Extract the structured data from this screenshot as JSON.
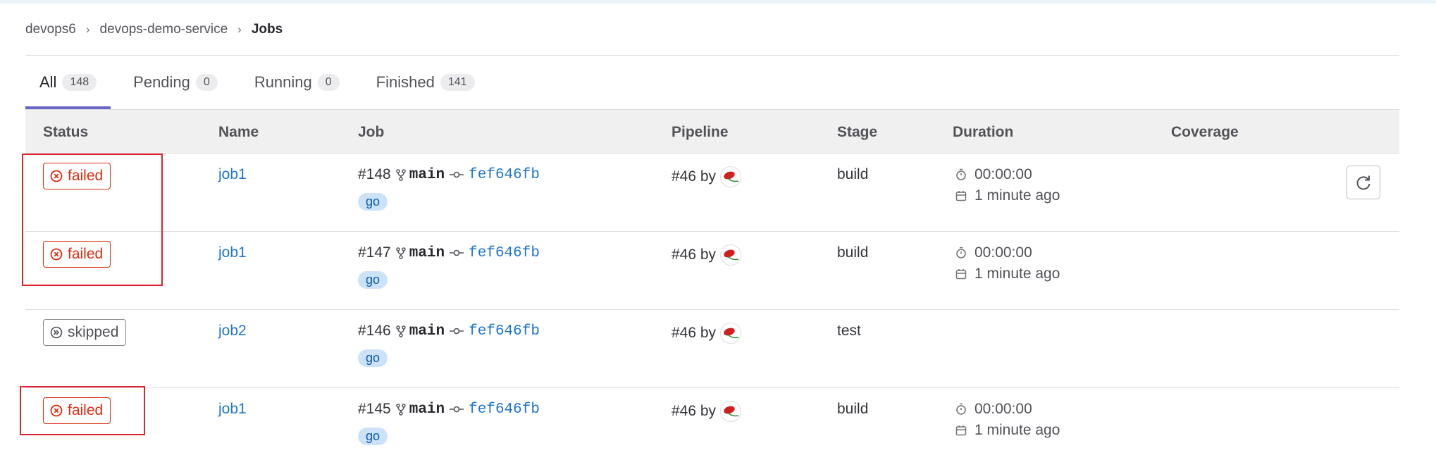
{
  "breadcrumb": {
    "items": [
      "devops6",
      "devops-demo-service"
    ],
    "current": "Jobs"
  },
  "tabs": [
    {
      "label": "All",
      "count": "148"
    },
    {
      "label": "Pending",
      "count": "0"
    },
    {
      "label": "Running",
      "count": "0"
    },
    {
      "label": "Finished",
      "count": "141"
    }
  ],
  "columns": [
    "Status",
    "Name",
    "Job",
    "Pipeline",
    "Stage",
    "Duration",
    "Coverage"
  ],
  "rows": [
    {
      "status": "failed",
      "name": "job1",
      "id": "#148",
      "branch": "main",
      "sha": "fef646fb",
      "tag": "go",
      "pipeline": "#46 by",
      "stage": "build",
      "duration": "00:00:00",
      "finished": "1 minute ago"
    },
    {
      "status": "failed",
      "name": "job1",
      "id": "#147",
      "branch": "main",
      "sha": "fef646fb",
      "tag": "go",
      "pipeline": "#46 by",
      "stage": "build",
      "duration": "00:00:00",
      "finished": "1 minute ago"
    },
    {
      "status": "skipped",
      "name": "job2",
      "id": "#146",
      "branch": "main",
      "sha": "fef646fb",
      "tag": "go",
      "pipeline": "#46 by",
      "stage": "test",
      "duration": "",
      "finished": ""
    },
    {
      "status": "failed",
      "name": "job1",
      "id": "#145",
      "branch": "main",
      "sha": "fef646fb",
      "tag": "go",
      "pipeline": "#46 by",
      "stage": "build",
      "duration": "00:00:00",
      "finished": "1 minute ago"
    }
  ],
  "colors": {
    "failed": "#dd2b0e",
    "link": "#1f75cb",
    "tab_active": "#6666c4",
    "highlight_box": "#e0202a"
  }
}
